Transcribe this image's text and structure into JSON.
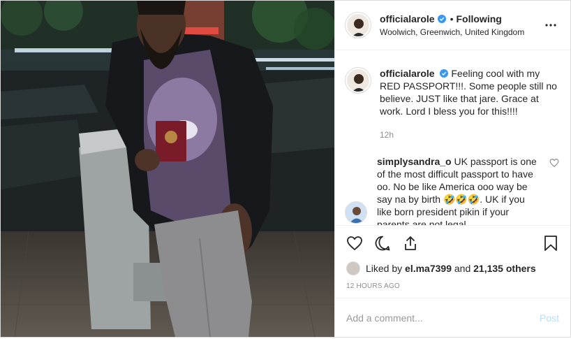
{
  "post": {
    "username": "officialarole",
    "follow_status": "Following",
    "separator": "•",
    "location": "Woolwich, Greenwich, United Kingdom"
  },
  "caption": {
    "username": "officialarole",
    "text": "Feeling cool with my RED PASSPORT!!!. Some people still no believe. JUST like that jare. Grace at work. Lord I bless you for this!!!!",
    "time": "12h"
  },
  "comments": [
    {
      "username": "simplysandra_o",
      "text": "UK passport is one of the most difficult passport to have oo. No be like America ooo way be say na by birth 🤣🤣🤣. UK if you like born president pikin if your parents are not legal"
    }
  ],
  "likes": {
    "prefix": "Liked by",
    "user": "el.ma7399",
    "and": "and",
    "others": "21,135 others"
  },
  "timestamp": "12 HOURS AGO",
  "add_comment": {
    "placeholder": "Add a comment...",
    "post_label": "Post"
  },
  "colors": {
    "verified": "#3897f0",
    "post_button_disabled": "#b2dffc",
    "secondary_text": "#8e8e8e"
  },
  "icons": {
    "more": "more-options-icon",
    "like": "heart-icon",
    "comment": "comment-icon",
    "share": "share-icon",
    "save": "bookmark-icon"
  }
}
